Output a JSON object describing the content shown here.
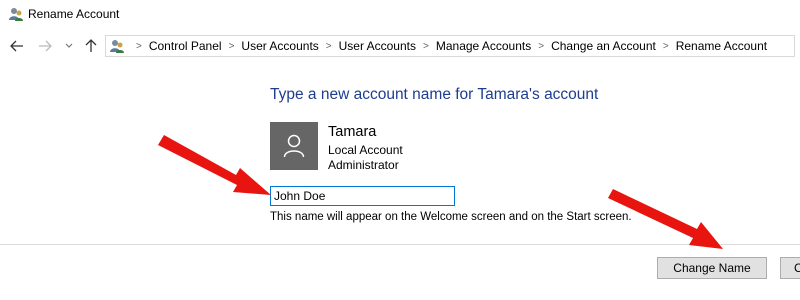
{
  "window": {
    "title": "Rename Account",
    "icon": "user-accounts-icon"
  },
  "nav": {
    "back": "back-arrow-icon",
    "forward": "forward-arrow-icon",
    "recent": "chevron-down-icon",
    "up": "up-arrow-icon"
  },
  "breadcrumb": [
    "Control Panel",
    "User Accounts",
    "User Accounts",
    "Manage Accounts",
    "Change an Account",
    "Rename Account"
  ],
  "main": {
    "heading": "Type a new account name for Tamara's account",
    "account": {
      "name": "Tamara",
      "type": "Local Account",
      "role": "Administrator"
    },
    "name_input_value": "John Doe",
    "hint": "This name will appear on the Welcome screen and on the Start screen."
  },
  "buttons": {
    "change_name": "Change Name",
    "cancel": "Cancel"
  },
  "colors": {
    "heading": "#1e3d8f",
    "arrow": "#e8140f",
    "avatar_bg": "#666666",
    "input_border": "#0078d7"
  }
}
